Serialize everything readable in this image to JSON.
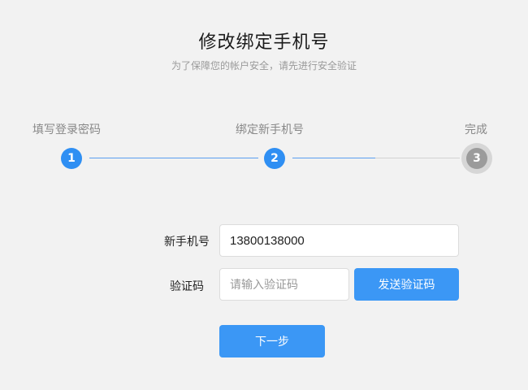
{
  "header": {
    "title": "修改绑定手机号",
    "subtitle": "为了保障您的帐户安全，请先进行安全验证"
  },
  "steps": [
    {
      "label": "填写登录密码",
      "number": "1",
      "status": "done"
    },
    {
      "label": "绑定新手机号",
      "number": "2",
      "status": "current"
    },
    {
      "label": "完成",
      "number": "3",
      "status": "pending"
    }
  ],
  "progress": {
    "current_step": 2,
    "total_steps": 3
  },
  "form": {
    "phone_label": "新手机号",
    "phone_value": "13800138000",
    "code_label": "验证码",
    "code_placeholder": "请输入验证码",
    "send_code_label": "发送验证码",
    "next_label": "下一步"
  },
  "colors": {
    "accent": "#3b97f5",
    "step_active": "#2f8ff3",
    "step_pending": "#9b9b9b",
    "background": "#f2f2f2"
  }
}
